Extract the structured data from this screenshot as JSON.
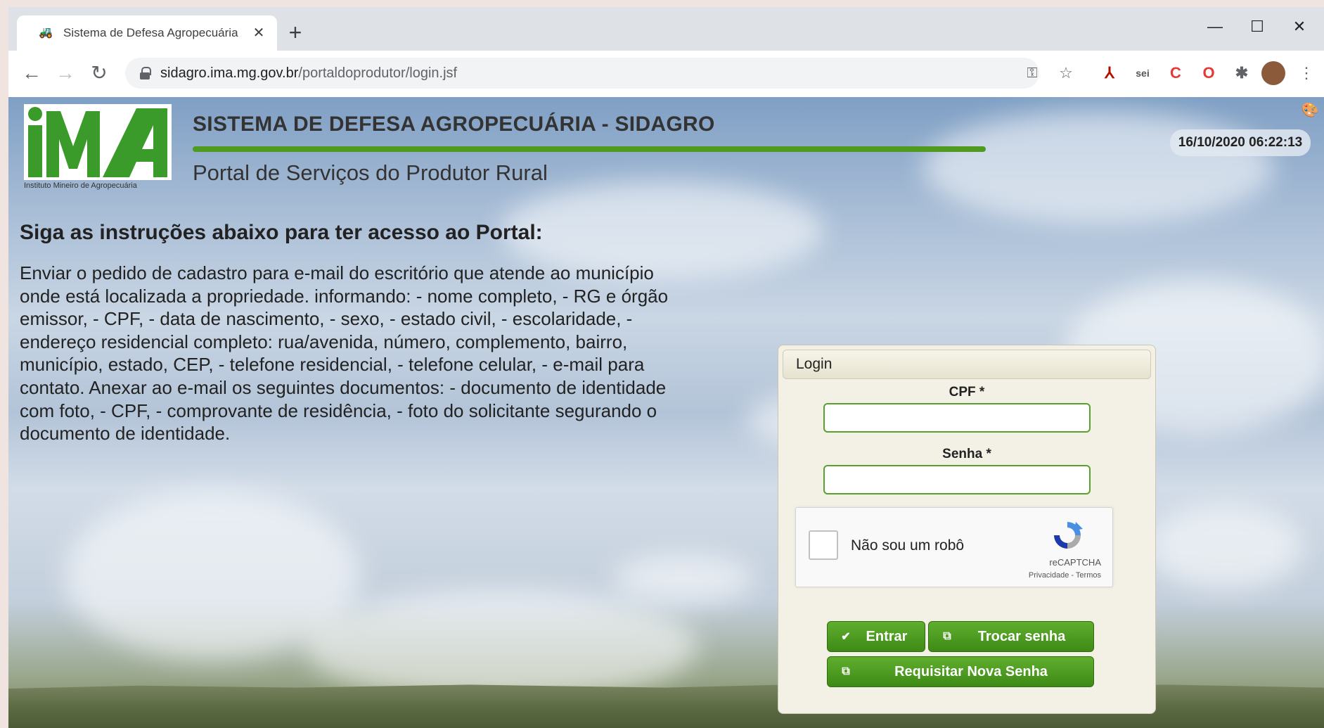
{
  "browser": {
    "tab_title": "Sistema de Defesa Agropecuária",
    "tab_close": "✕",
    "new_tab": "+",
    "url_host": "sidagro.ima.mg.gov.br",
    "url_path": "/portaldoprodutor/login.jsf",
    "minimize": "—",
    "maximize": "☐",
    "close": "✕",
    "extensions": [
      {
        "name": "acrobat-icon",
        "glyph": "⅄",
        "color": "#b30b00"
      },
      {
        "name": "sei-icon",
        "glyph": "sei",
        "color": "#555555"
      },
      {
        "name": "adblock-icon",
        "glyph": "C",
        "color": "#e53935"
      },
      {
        "name": "opera-icon",
        "glyph": "O",
        "color": "#e53935"
      },
      {
        "name": "puzzle-icon",
        "glyph": "✱",
        "color": "#5f6368"
      }
    ]
  },
  "header": {
    "logo_text": "IMA",
    "logo_subtitle": "Instituto Mineiro de Agropecuária",
    "system_title": "SISTEMA DE DEFESA AGROPECUÁRIA - SIDAGRO",
    "portal_subtitle": "Portal de Serviços do Produtor Rural",
    "datetime": "16/10/2020 06:22:13"
  },
  "instructions": {
    "title": "Siga as instruções abaixo para ter acesso ao Portal:",
    "body": "Enviar o pedido de cadastro para e-mail do escritório que atende ao município onde está localizada a propriedade. informando: - nome completo, - RG e órgão emissor, - CPF, - data de nascimento, - sexo, - estado civil, - escolaridade, - endereço residencial completo: rua/avenida, número, complemento, bairro, município, estado, CEP, - telefone residencial, - telefone celular, - e-mail para contato. Anexar ao e-mail os seguintes documentos: - documento de identidade com foto, - CPF, - comprovante de residência, - foto do solicitante segurando o documento de identidade."
  },
  "login": {
    "panel_title": "Login",
    "cpf_label": "CPF *",
    "cpf_value": "",
    "senha_label": "Senha *",
    "senha_value": "",
    "captcha_label": "Não sou um robô",
    "captcha_brand": "reCAPTCHA",
    "captcha_links": "Privacidade - Termos",
    "btn_entrar": "Entrar",
    "btn_trocar": "Trocar senha",
    "btn_requisitar": "Requisitar Nova Senha"
  },
  "colors": {
    "accent_green": "#4f9a1f",
    "button_green": "#3e8a16"
  }
}
